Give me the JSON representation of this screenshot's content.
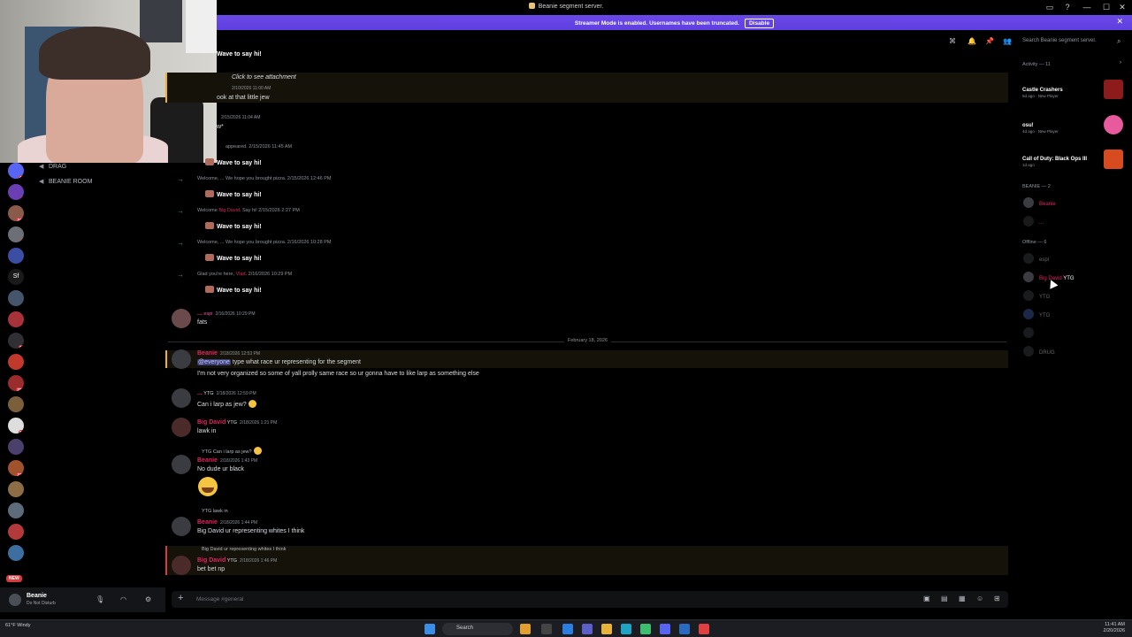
{
  "window": {
    "title": "Beanie segment server.",
    "controls": [
      "—",
      "☐",
      "✕"
    ]
  },
  "banner": {
    "text": "Streamer Mode is enabled. Usernames have been truncated.",
    "button": "Disable"
  },
  "channels": [
    {
      "label": "DRAG",
      "icon": "speaker-icon"
    },
    {
      "label": "BEANIE ROOM",
      "icon": "speaker-icon"
    }
  ],
  "server_badges": [
    "43",
    "6",
    "344",
    "7",
    "",
    "6",
    "",
    "",
    "",
    "4",
    "11",
    "",
    "221",
    "",
    "38",
    "",
    "274",
    "",
    "",
    "",
    "",
    ""
  ],
  "server_new": "NEW",
  "user": {
    "name": "Beanie",
    "status": "Do Not Disturb"
  },
  "search": {
    "placeholder": "Search Beanie segment server."
  },
  "messages": {
    "m0": "Wave to say hi!",
    "m1_text": "Click to see attachment",
    "m1_ts": "2/10/2026 11:00 AM",
    "m1b": "ook at that little jew",
    "m2_ts": "2/15/2026 11:04 AM",
    "m2": "w*",
    "j1": "appeared. 2/15/2026 11:45 AM",
    "w1": "Wave to say hi!",
    "j2": "Welcome, ... We hope you brought pizza. 2/15/2026 12:46 PM",
    "w2": "Wave to say hi!",
    "j3a": "Welcome",
    "j3n": "Big David",
    "j3b": ". Say hi! 2/15/2026 2:27 PM",
    "w3": "Wave to say hi!",
    "j4": "Welcome, ... We hope you brought pizza. 2/16/2026 10:28 PM",
    "w4": "Wave to say hi!",
    "j5a": "Glad you're here,",
    "j5n": "Vlad",
    "j5b": ". 2/16/2026 10:29 PM",
    "w5": "Wave to say hi!",
    "u1_name": "...",
    "u1_tag": "espi",
    "u1_ts": "2/16/2026 10:29 PM",
    "u1_text": "fats",
    "date": "February 18, 2026",
    "b1_name": "Beanie",
    "b1_ts": "2/18/2026 12:53 PM",
    "b1_mention": "@everyone",
    "b1_text": " type what race ur representing for the segment",
    "b1_text2": "I'm not very organized so some of yall prolly same race so ur gonna have to like larp as something else",
    "u2_tag": "YTG",
    "u2_ts": "2/18/2026 12:59 PM",
    "u2_text": "Can i larp as jew?",
    "d1_name": "Big David",
    "d1_tag": "YTG",
    "d1_ts": "2/18/2026 1:21 PM",
    "d1_text": "lawk in",
    "r1": "YTG Can i larp as jew?",
    "b2_name": "Beanie",
    "b2_ts": "2/18/2026 1:43 PM",
    "b2_text": "No dude ur black",
    "r2": "YTG lawk in",
    "b3_name": "Beanie",
    "b3_ts": "2/18/2026 1:44 PM",
    "b3_text": "Big David ur representing whites I think",
    "r3": "Big David ur representing whites I think",
    "d2_name": "Big David",
    "d2_tag": "YTG",
    "d2_ts": "2/18/2026 1:46 PM",
    "d2_text": "bet bet np"
  },
  "composer": {
    "placeholder": "Message #general"
  },
  "members": {
    "activity_header": "Activity — 11",
    "activities": [
      {
        "title": "Castle Crashers",
        "meta": "5d ago · New Player",
        "color": "#c9302c"
      },
      {
        "title": "osu!",
        "meta": "4d ago · New Player",
        "color": "#e85a9e"
      },
      {
        "title": "Call of Duty: Black Ops III",
        "meta": "1d ago",
        "color": "#e7552a"
      }
    ],
    "role_header": "BEANIE — 2",
    "role_members": [
      "Beanie",
      "..."
    ],
    "offline_header": "Offline — 6",
    "offline_members": [
      "espi",
      "Big David",
      "YTG",
      "YTG",
      "",
      "DRUG"
    ]
  },
  "taskbar": {
    "weather": "61°F Windy",
    "search": "Search",
    "time": "11:41 AM",
    "date": "2/20/2026"
  }
}
